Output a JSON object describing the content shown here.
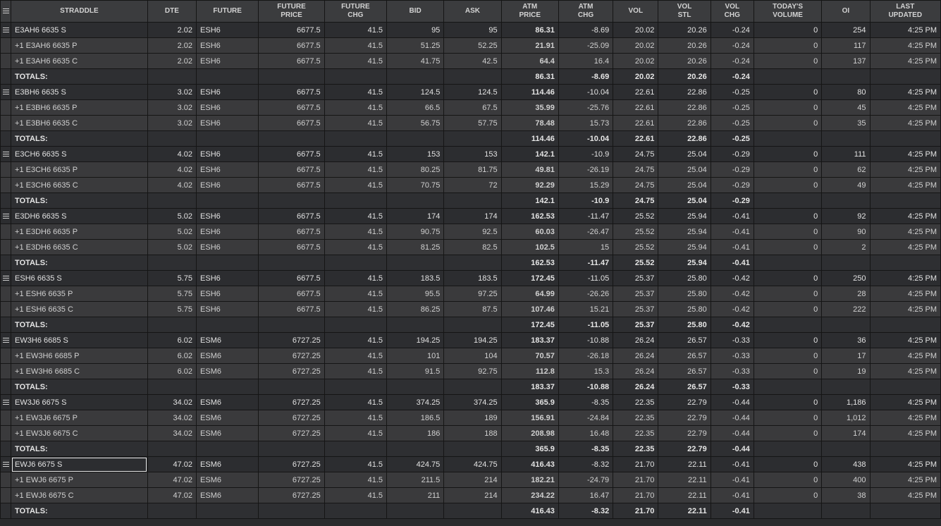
{
  "columns": [
    "STRADDLE",
    "DTE",
    "FUTURE",
    "FUTURE PRICE",
    "FUTURE CHG",
    "BID",
    "ASK",
    "ATM PRICE",
    "ATM CHG",
    "VOL",
    "VOL STL",
    "VOL CHG",
    "TODAY'S VOLUME",
    "OI",
    "LAST UPDATED"
  ],
  "header_lines": [
    [
      "STRADDLE"
    ],
    [
      "DTE"
    ],
    [
      "FUTURE"
    ],
    [
      "FUTURE",
      "PRICE"
    ],
    [
      "FUTURE",
      "CHG"
    ],
    [
      "BID"
    ],
    [
      "ASK"
    ],
    [
      "ATM",
      "PRICE"
    ],
    [
      "ATM",
      "CHG"
    ],
    [
      "VOL"
    ],
    [
      "VOL",
      "STL"
    ],
    [
      "VOL",
      "CHG"
    ],
    [
      "TODAY'S",
      "VOLUME"
    ],
    [
      "OI"
    ],
    [
      "LAST",
      "UPDATED"
    ]
  ],
  "colors": {
    "positive": "#5ad25a",
    "negative": "#ff5a5a",
    "background": "#2a2b2d"
  },
  "totals_label": "TOTALS:",
  "groups": [
    {
      "rows": [
        [
          "E3AH6 6635 S",
          "2.02",
          "ESH6",
          "6677.5",
          "41.5",
          "95",
          "95",
          "86.31",
          "-8.69",
          "20.02",
          "20.26",
          "-0.24",
          "0",
          "254",
          "4:25 PM"
        ],
        [
          "+1 E3AH6 6635 P",
          "2.02",
          "ESH6",
          "6677.5",
          "41.5",
          "51.25",
          "52.25",
          "21.91",
          "-25.09",
          "20.02",
          "20.26",
          "-0.24",
          "0",
          "117",
          "4:25 PM"
        ],
        [
          "+1 E3AH6 6635 C",
          "2.02",
          "ESH6",
          "6677.5",
          "41.5",
          "41.75",
          "42.5",
          "64.4",
          "16.4",
          "20.02",
          "20.26",
          "-0.24",
          "0",
          "137",
          "4:25 PM"
        ]
      ],
      "totals": {
        "atm_price": "86.31",
        "atm_chg": "-8.69",
        "vol": "20.02",
        "vol_stl": "20.26",
        "vol_chg": "-0.24"
      }
    },
    {
      "rows": [
        [
          "E3BH6 6635 S",
          "3.02",
          "ESH6",
          "6677.5",
          "41.5",
          "124.5",
          "124.5",
          "114.46",
          "-10.04",
          "22.61",
          "22.86",
          "-0.25",
          "0",
          "80",
          "4:25 PM"
        ],
        [
          "+1 E3BH6 6635 P",
          "3.02",
          "ESH6",
          "6677.5",
          "41.5",
          "66.5",
          "67.5",
          "35.99",
          "-25.76",
          "22.61",
          "22.86",
          "-0.25",
          "0",
          "45",
          "4:25 PM"
        ],
        [
          "+1 E3BH6 6635 C",
          "3.02",
          "ESH6",
          "6677.5",
          "41.5",
          "56.75",
          "57.75",
          "78.48",
          "15.73",
          "22.61",
          "22.86",
          "-0.25",
          "0",
          "35",
          "4:25 PM"
        ]
      ],
      "totals": {
        "atm_price": "114.46",
        "atm_chg": "-10.04",
        "vol": "22.61",
        "vol_stl": "22.86",
        "vol_chg": "-0.25"
      }
    },
    {
      "rows": [
        [
          "E3CH6 6635 S",
          "4.02",
          "ESH6",
          "6677.5",
          "41.5",
          "153",
          "153",
          "142.1",
          "-10.9",
          "24.75",
          "25.04",
          "-0.29",
          "0",
          "111",
          "4:25 PM"
        ],
        [
          "+1 E3CH6 6635 P",
          "4.02",
          "ESH6",
          "6677.5",
          "41.5",
          "80.25",
          "81.75",
          "49.81",
          "-26.19",
          "24.75",
          "25.04",
          "-0.29",
          "0",
          "62",
          "4:25 PM"
        ],
        [
          "+1 E3CH6 6635 C",
          "4.02",
          "ESH6",
          "6677.5",
          "41.5",
          "70.75",
          "72",
          "92.29",
          "15.29",
          "24.75",
          "25.04",
          "-0.29",
          "0",
          "49",
          "4:25 PM"
        ]
      ],
      "totals": {
        "atm_price": "142.1",
        "atm_chg": "-10.9",
        "vol": "24.75",
        "vol_stl": "25.04",
        "vol_chg": "-0.29"
      }
    },
    {
      "rows": [
        [
          "E3DH6 6635 S",
          "5.02",
          "ESH6",
          "6677.5",
          "41.5",
          "174",
          "174",
          "162.53",
          "-11.47",
          "25.52",
          "25.94",
          "-0.41",
          "0",
          "92",
          "4:25 PM"
        ],
        [
          "+1 E3DH6 6635 P",
          "5.02",
          "ESH6",
          "6677.5",
          "41.5",
          "90.75",
          "92.5",
          "60.03",
          "-26.47",
          "25.52",
          "25.94",
          "-0.41",
          "0",
          "90",
          "4:25 PM"
        ],
        [
          "+1 E3DH6 6635 C",
          "5.02",
          "ESH6",
          "6677.5",
          "41.5",
          "81.25",
          "82.5",
          "102.5",
          "15",
          "25.52",
          "25.94",
          "-0.41",
          "0",
          "2",
          "4:25 PM"
        ]
      ],
      "totals": {
        "atm_price": "162.53",
        "atm_chg": "-11.47",
        "vol": "25.52",
        "vol_stl": "25.94",
        "vol_chg": "-0.41"
      }
    },
    {
      "rows": [
        [
          "ESH6 6635 S",
          "5.75",
          "ESH6",
          "6677.5",
          "41.5",
          "183.5",
          "183.5",
          "172.45",
          "-11.05",
          "25.37",
          "25.80",
          "-0.42",
          "0",
          "250",
          "4:25 PM"
        ],
        [
          "+1 ESH6 6635 P",
          "5.75",
          "ESH6",
          "6677.5",
          "41.5",
          "95.5",
          "97.25",
          "64.99",
          "-26.26",
          "25.37",
          "25.80",
          "-0.42",
          "0",
          "28",
          "4:25 PM"
        ],
        [
          "+1 ESH6 6635 C",
          "5.75",
          "ESH6",
          "6677.5",
          "41.5",
          "86.25",
          "87.5",
          "107.46",
          "15.21",
          "25.37",
          "25.80",
          "-0.42",
          "0",
          "222",
          "4:25 PM"
        ]
      ],
      "totals": {
        "atm_price": "172.45",
        "atm_chg": "-11.05",
        "vol": "25.37",
        "vol_stl": "25.80",
        "vol_chg": "-0.42"
      }
    },
    {
      "rows": [
        [
          "EW3H6 6685 S",
          "6.02",
          "ESM6",
          "6727.25",
          "41.5",
          "194.25",
          "194.25",
          "183.37",
          "-10.88",
          "26.24",
          "26.57",
          "-0.33",
          "0",
          "36",
          "4:25 PM"
        ],
        [
          "+1 EW3H6 6685 P",
          "6.02",
          "ESM6",
          "6727.25",
          "41.5",
          "101",
          "104",
          "70.57",
          "-26.18",
          "26.24",
          "26.57",
          "-0.33",
          "0",
          "17",
          "4:25 PM"
        ],
        [
          "+1 EW3H6 6685 C",
          "6.02",
          "ESM6",
          "6727.25",
          "41.5",
          "91.5",
          "92.75",
          "112.8",
          "15.3",
          "26.24",
          "26.57",
          "-0.33",
          "0",
          "19",
          "4:25 PM"
        ]
      ],
      "totals": {
        "atm_price": "183.37",
        "atm_chg": "-10.88",
        "vol": "26.24",
        "vol_stl": "26.57",
        "vol_chg": "-0.33"
      }
    },
    {
      "rows": [
        [
          "EW3J6 6675 S",
          "34.02",
          "ESM6",
          "6727.25",
          "41.5",
          "374.25",
          "374.25",
          "365.9",
          "-8.35",
          "22.35",
          "22.79",
          "-0.44",
          "0",
          "1,186",
          "4:25 PM"
        ],
        [
          "+1 EW3J6 6675 P",
          "34.02",
          "ESM6",
          "6727.25",
          "41.5",
          "186.5",
          "189",
          "156.91",
          "-24.84",
          "22.35",
          "22.79",
          "-0.44",
          "0",
          "1,012",
          "4:25 PM"
        ],
        [
          "+1 EW3J6 6675 C",
          "34.02",
          "ESM6",
          "6727.25",
          "41.5",
          "186",
          "188",
          "208.98",
          "16.48",
          "22.35",
          "22.79",
          "-0.44",
          "0",
          "174",
          "4:25 PM"
        ]
      ],
      "totals": {
        "atm_price": "365.9",
        "atm_chg": "-8.35",
        "vol": "22.35",
        "vol_stl": "22.79",
        "vol_chg": "-0.44"
      }
    },
    {
      "rows": [
        [
          "EWJ6 6675 S",
          "47.02",
          "ESM6",
          "6727.25",
          "41.5",
          "424.75",
          "424.75",
          "416.43",
          "-8.32",
          "21.70",
          "22.11",
          "-0.41",
          "0",
          "438",
          "4:25 PM"
        ],
        [
          "+1 EWJ6 6675 P",
          "47.02",
          "ESM6",
          "6727.25",
          "41.5",
          "211.5",
          "214",
          "182.21",
          "-24.79",
          "21.70",
          "22.11",
          "-0.41",
          "0",
          "400",
          "4:25 PM"
        ],
        [
          "+1 EWJ6 6675 C",
          "47.02",
          "ESM6",
          "6727.25",
          "41.5",
          "211",
          "214",
          "234.22",
          "16.47",
          "21.70",
          "22.11",
          "-0.41",
          "0",
          "38",
          "4:25 PM"
        ]
      ],
      "totals": {
        "atm_price": "416.43",
        "atm_chg": "-8.32",
        "vol": "21.70",
        "vol_stl": "22.11",
        "vol_chg": "-0.41"
      }
    }
  ]
}
